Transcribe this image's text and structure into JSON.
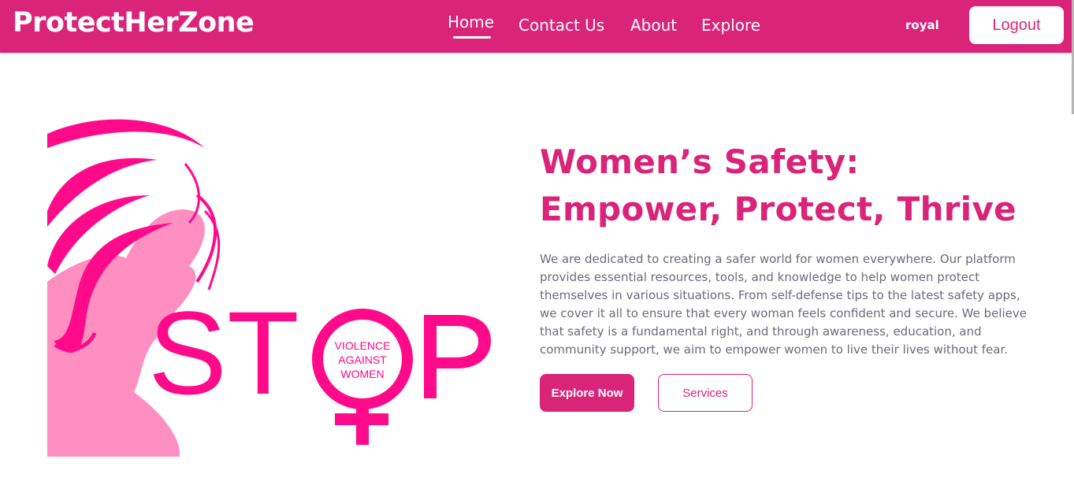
{
  "navbar": {
    "brand": "ProtectHerZone",
    "links": [
      "Home",
      "Contact Us",
      "About",
      "Explore"
    ],
    "active_link": "Home",
    "username": "royal",
    "logout_label": "Logout"
  },
  "hero": {
    "art": {
      "stop_text": "STOP",
      "symbol_lines": [
        "VIOLENCE",
        "AGAINST",
        "WOMEN"
      ]
    },
    "headline": "Women’s Safety: Empower, Protect, Thrive",
    "description": "We are dedicated to creating a safer world for women everywhere. Our platform provides essential resources, tools, and knowledge to help women protect themselves in various situations. From self-defense tips to the latest safety apps, we cover it all to ensure that every woman feels confident and secure. We believe that safety is a fundamental right, and through awareness, education, and community support, we aim to empower women to live their lives without fear.",
    "primary_button": "Explore Now",
    "secondary_button": "Services"
  },
  "colors": {
    "brand_pink": "#d9247a",
    "hot_pink": "#ff0a8a",
    "light_pink": "#ff8fc0",
    "body_text": "#6b6b7b"
  }
}
